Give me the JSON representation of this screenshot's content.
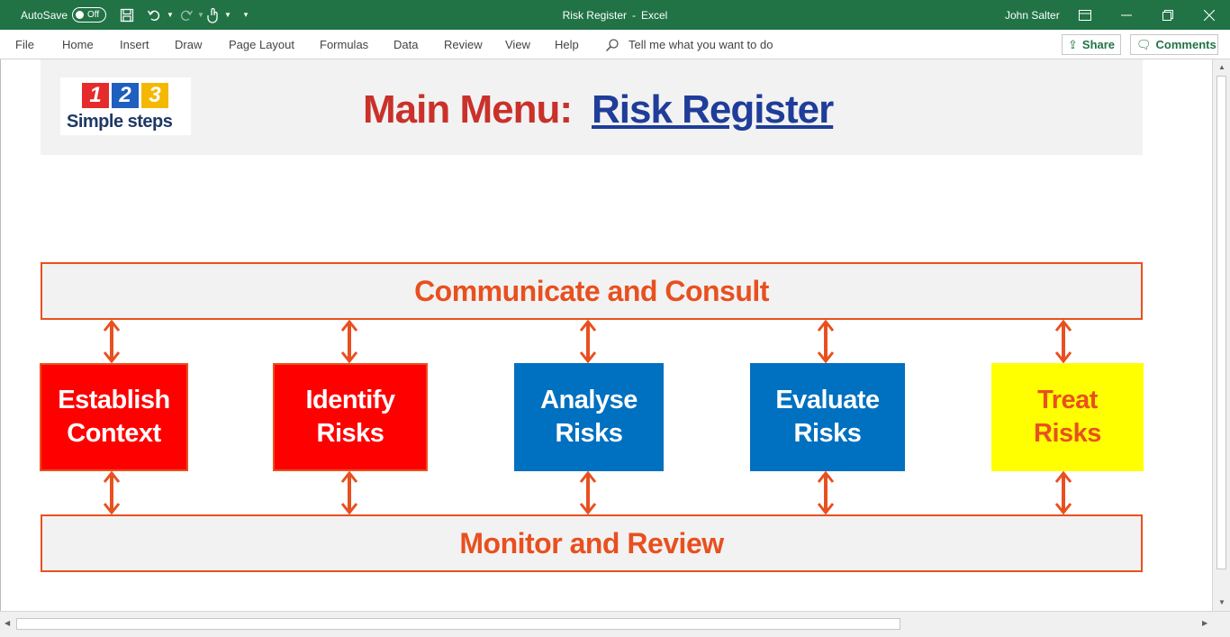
{
  "titlebar": {
    "autosave_label": "AutoSave",
    "autosave_state": "Off",
    "doc_title": "Risk Register",
    "separator": "-",
    "app_name": "Excel",
    "user": "John Salter"
  },
  "ribbon": {
    "tabs": [
      "File",
      "Home",
      "Insert",
      "Draw",
      "Page Layout",
      "Formulas",
      "Data",
      "Review",
      "View",
      "Help"
    ],
    "tellme": "Tell me what you want to do",
    "share": "Share",
    "comments": "Comments"
  },
  "logo": {
    "digits": [
      "1",
      "2",
      "3"
    ],
    "tagline": "Simple steps"
  },
  "main_menu": {
    "label": "Main Menu:",
    "link": "Risk Register"
  },
  "diagram": {
    "top_band": "Communicate and Consult",
    "bottom_band": "Monitor and Review",
    "steps": [
      {
        "label": "Establish\nContext",
        "color": "#ff0000"
      },
      {
        "label": "Identify\nRisks",
        "color": "#ff0000"
      },
      {
        "label": "Analyse\nRisks",
        "color": "#0070c0"
      },
      {
        "label": "Evaluate\nRisks",
        "color": "#0070c0"
      },
      {
        "label": "Treat\nRisks",
        "color": "#ffff00"
      }
    ],
    "accent": "#e8501f"
  },
  "colors": {
    "excel_green": "#217346",
    "title_red": "#c9312a",
    "link_blue": "#1f3d99"
  }
}
